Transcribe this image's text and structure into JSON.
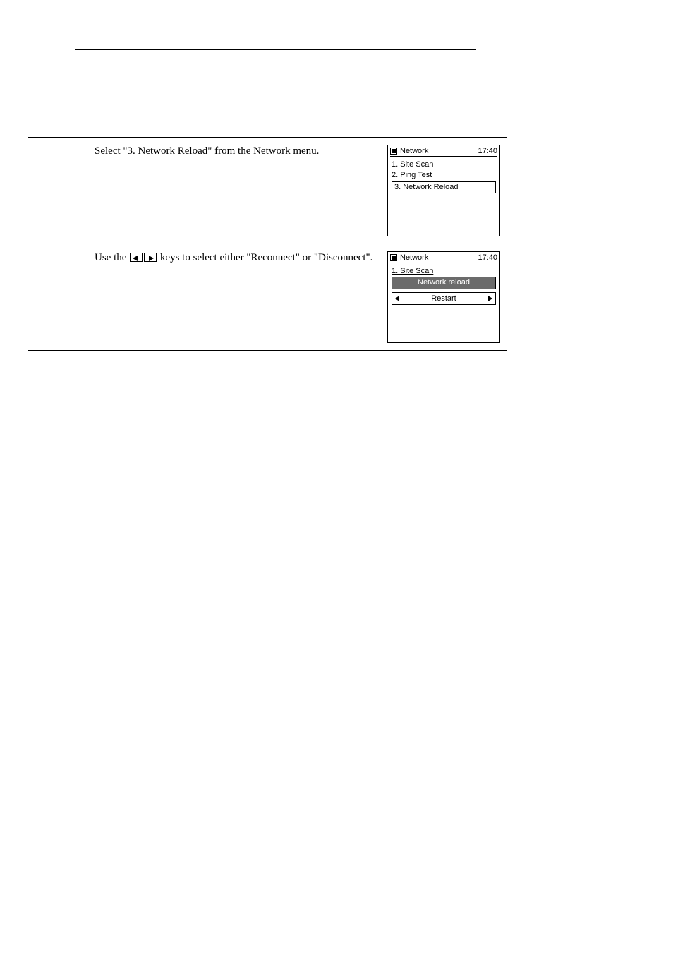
{
  "steps": [
    {
      "desc_pre": "Select \"3. Network Reload\" from the Network menu.",
      "desc_post": "",
      "has_keys": false,
      "screen": {
        "title": "Network",
        "time": "17:40",
        "lines": [
          "1.  Site Scan",
          "2.  Ping Test"
        ],
        "boxed": "3.  Network Reload",
        "boxed_selected": false,
        "spinner": null,
        "under_line": null
      }
    },
    {
      "desc_pre": "Use the ",
      "desc_post": " keys to select either \"Reconnect\" or \"Disconnect\".",
      "has_keys": true,
      "screen": {
        "title": "Network",
        "time": "17:40",
        "lines": [],
        "under_line": "1.  Site Scan",
        "boxed": "Network reload",
        "boxed_selected": true,
        "spinner": "Restart"
      }
    }
  ]
}
